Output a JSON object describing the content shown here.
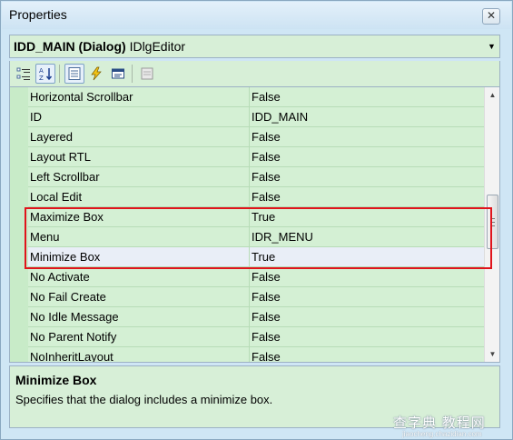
{
  "window": {
    "title": "Properties",
    "close_glyph": "✕"
  },
  "object_selector": {
    "name": "IDD_MAIN (Dialog)",
    "type": "IDlgEditor",
    "arrow_glyph": "▼"
  },
  "toolbar": {
    "buttons": [
      {
        "name": "categorized-icon",
        "active": false
      },
      {
        "name": "alphabetical-icon",
        "active": true
      },
      {
        "name": "properties-icon",
        "active": true
      },
      {
        "name": "events-icon",
        "active": false
      },
      {
        "name": "messages-icon",
        "active": false
      },
      {
        "name": "property-pages-icon",
        "active": false
      }
    ]
  },
  "properties": {
    "rows": [
      {
        "name": "Horizontal Scrollbar",
        "value": "False"
      },
      {
        "name": "ID",
        "value": "IDD_MAIN"
      },
      {
        "name": "Layered",
        "value": "False"
      },
      {
        "name": "Layout RTL",
        "value": "False"
      },
      {
        "name": "Left Scrollbar",
        "value": "False"
      },
      {
        "name": "Local Edit",
        "value": "False"
      },
      {
        "name": "Maximize Box",
        "value": "True"
      },
      {
        "name": "Menu",
        "value": "IDR_MENU"
      },
      {
        "name": "Minimize Box",
        "value": "True"
      },
      {
        "name": "No Activate",
        "value": "False"
      },
      {
        "name": "No Fail Create",
        "value": "False"
      },
      {
        "name": "No Idle Message",
        "value": "False"
      },
      {
        "name": "No Parent Notify",
        "value": "False"
      },
      {
        "name": "NoInheritLayout",
        "value": "False"
      }
    ],
    "selected_index": 8
  },
  "scrollbar": {
    "up_glyph": "▲",
    "down_glyph": "▼"
  },
  "description": {
    "title": "Minimize Box",
    "text": "Specifies that the dialog includes a minimize box."
  },
  "watermark": {
    "main": "查字典 教程网",
    "sub": "jiaocheng.chazidian.com"
  },
  "colors": {
    "grid_bg": "#d4f0d4",
    "selected_row": "#e9eef7",
    "highlight_border": "#e0141c"
  }
}
